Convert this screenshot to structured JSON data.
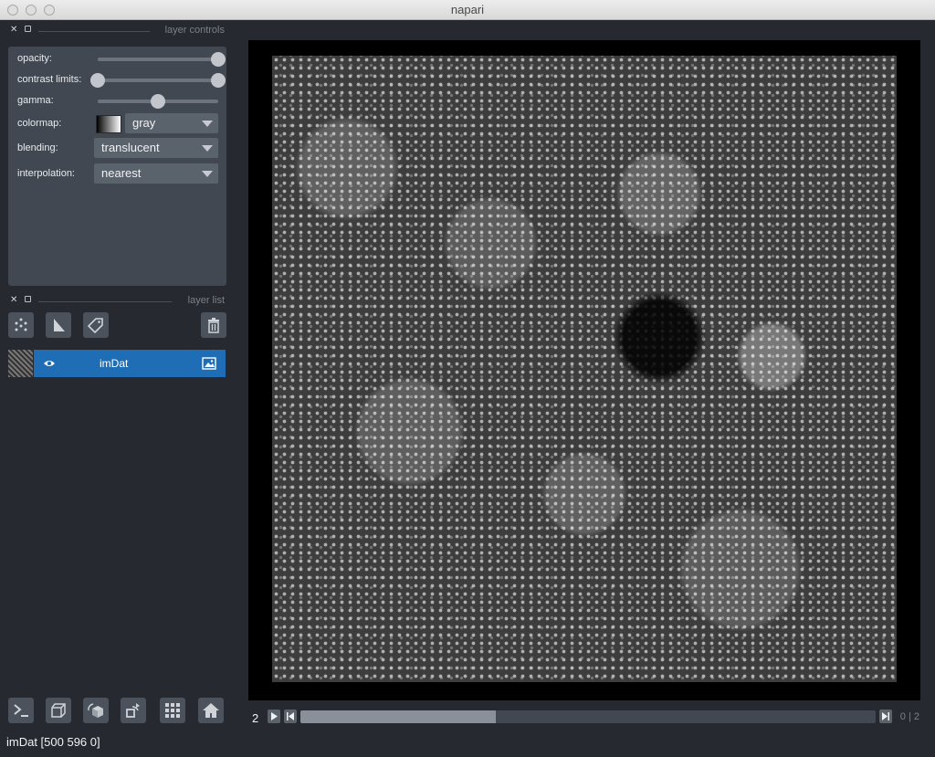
{
  "window": {
    "title": "napari"
  },
  "layer_controls": {
    "header": "layer controls",
    "opacity": {
      "label": "opacity:",
      "value": 1.0
    },
    "contrast_limits": {
      "label": "contrast limits:",
      "min": 0.0,
      "max": 1.0
    },
    "gamma": {
      "label": "gamma:",
      "value": 0.5
    },
    "colormap": {
      "label": "colormap:",
      "value": "gray"
    },
    "blending": {
      "label": "blending:",
      "value": "translucent"
    },
    "interpolation": {
      "label": "interpolation:",
      "value": "nearest"
    }
  },
  "layer_list": {
    "header": "layer list",
    "tools": [
      "new-points-icon",
      "new-shapes-icon",
      "new-labels-icon",
      "delete-icon"
    ],
    "layers": [
      {
        "name": "imDat",
        "visible": true,
        "selected": true,
        "type_icon": "image-icon"
      }
    ]
  },
  "viewer_buttons": [
    "console-icon",
    "ndisplay-3d-icon",
    "roll-dims-icon",
    "transpose-icon",
    "grid-icon",
    "home-icon"
  ],
  "dims": {
    "current": "2",
    "max": "2",
    "separator": "|",
    "slider_fraction": 0.34,
    "left_value": "0"
  },
  "status": {
    "text": "imDat [500 596    0]"
  },
  "colors": {
    "bg": "#262930",
    "panel": "#414851",
    "selection": "#1e6db5",
    "canvas": "#000000"
  }
}
